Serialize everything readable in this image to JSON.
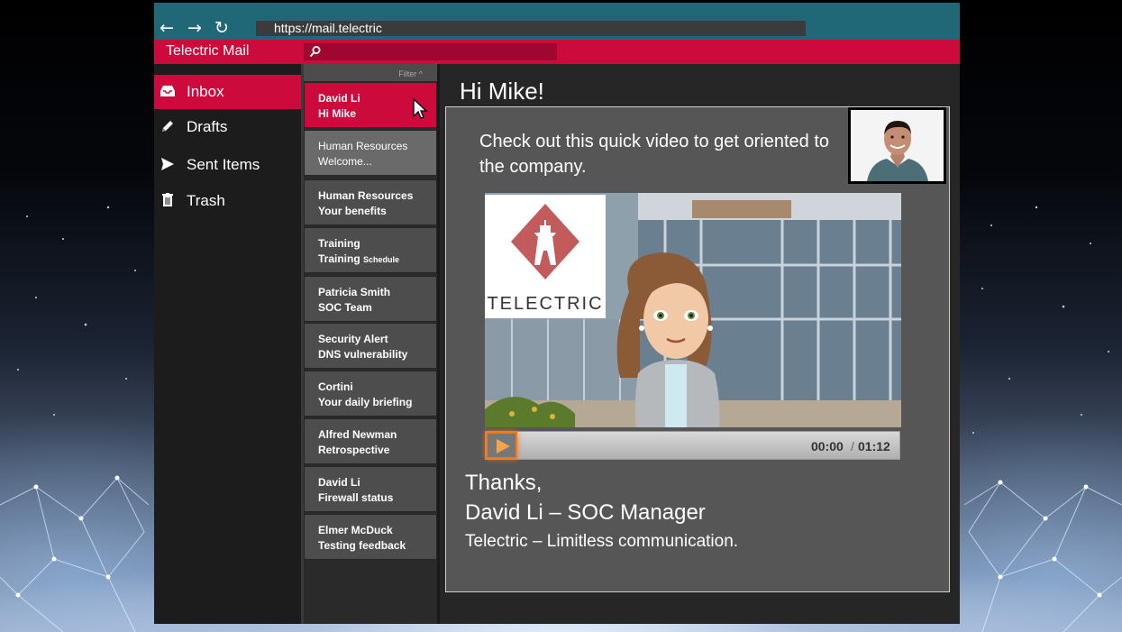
{
  "browser": {
    "back_icon": "arrow-left-icon",
    "forward_icon": "arrow-right-icon",
    "reload_icon": "reload-icon",
    "url": "https://mail.telectric"
  },
  "header": {
    "title": "Telectric Mail",
    "search_icon": "search-icon",
    "color": "#cc0a3c"
  },
  "sidebar": {
    "items": [
      {
        "label": "Inbox",
        "icon": "inbox-icon",
        "active": true
      },
      {
        "label": "Drafts",
        "icon": "pencil-icon"
      },
      {
        "label": "Sent Items",
        "icon": "send-icon"
      },
      {
        "label": "Trash",
        "icon": "trash-icon"
      }
    ]
  },
  "message_list": {
    "filter_label": "Filter ^",
    "messages": [
      {
        "sender": "David Li",
        "subject": "Hi Mike",
        "state": "selected"
      },
      {
        "sender": "Human Resources",
        "subject": "Welcome...",
        "state": "read"
      },
      {
        "sender": "Human Resources",
        "subject": "Your benefits",
        "state": "unread"
      },
      {
        "sender": "Training",
        "subject": "Training",
        "subject_small": "Schedule",
        "state": "unread"
      },
      {
        "sender": "Patricia Smith",
        "subject": "SOC Team",
        "state": "unread"
      },
      {
        "sender": "Security Alert",
        "subject": "DNS vulnerability",
        "state": "unread"
      },
      {
        "sender": "Cortini",
        "subject": "Your daily briefing",
        "state": "unread"
      },
      {
        "sender": "Alfred Newman",
        "subject": "Retrospective",
        "state": "unread"
      },
      {
        "sender": "David Li",
        "subject": "Firewall status",
        "state": "unread"
      },
      {
        "sender": "Elmer McDuck",
        "subject": "Testing feedback",
        "state": "unread"
      }
    ]
  },
  "email": {
    "greeting": "Hi Mike!",
    "body": "Check out this quick video to get oriented to the company.",
    "video": {
      "logo_text": "TELECTRIC",
      "time_current": "00:00",
      "time_separator": "/",
      "time_total": "01:12",
      "progress": 0
    },
    "closing": "Thanks,",
    "signature": "David Li – SOC Manager",
    "tagline": "Telectric – Limitless communication."
  }
}
